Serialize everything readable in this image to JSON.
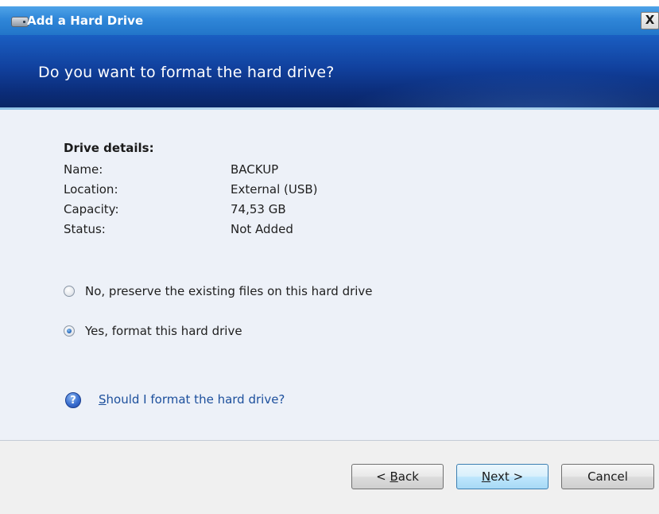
{
  "window": {
    "title": "Add a Hard Drive",
    "close_label": "X"
  },
  "banner": {
    "heading": "Do you want to format the hard drive?"
  },
  "details": {
    "title": "Drive details:",
    "rows": [
      {
        "label": "Name:",
        "value": "BACKUP"
      },
      {
        "label": "Location:",
        "value": "External (USB)"
      },
      {
        "label": "Capacity:",
        "value": "74,53 GB"
      },
      {
        "label": "Status:",
        "value": "Not Added"
      }
    ]
  },
  "options": {
    "preserve_label": "No, preserve the existing files on this hard drive",
    "preserve_selected": false,
    "format_label": "Yes, format this hard drive",
    "format_selected": true
  },
  "help": {
    "icon": "question-icon",
    "icon_glyph": "?",
    "link_accesskey": "S",
    "link_rest": "hould I format the hard drive?"
  },
  "buttons": {
    "back_prefix": "< ",
    "back_accesskey": "B",
    "back_rest": "ack",
    "next_accesskey": "N",
    "next_rest": "ext >",
    "cancel_label": "Cancel"
  }
}
